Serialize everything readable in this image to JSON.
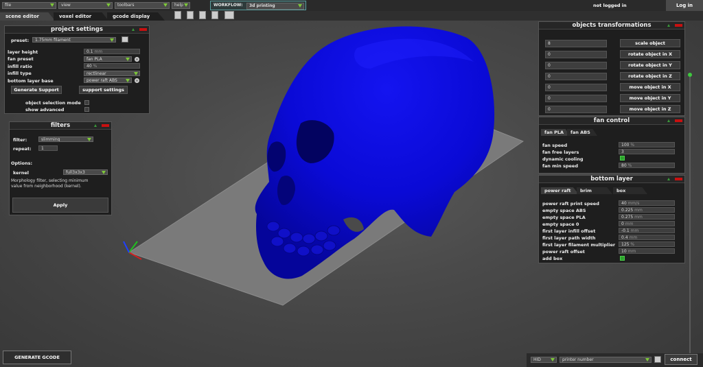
{
  "menus": [
    {
      "label": "file"
    },
    {
      "label": "view"
    },
    {
      "label": "toolbars"
    },
    {
      "label": "help"
    }
  ],
  "workflow": {
    "label": "WORKFLOW:",
    "value": "3d printing"
  },
  "auth": {
    "status": "not logged in",
    "login_label": "Log in"
  },
  "tabs": [
    {
      "label": "scene editor"
    },
    {
      "label": "voxel editor"
    },
    {
      "label": "gcode display"
    }
  ],
  "project_settings": {
    "title": "project settings",
    "preset_label": "preset:",
    "preset_value": "1.75mm filament",
    "rows": [
      {
        "label": "layer height",
        "value": "0.1",
        "unit": "mm",
        "kind": "field"
      },
      {
        "label": "fan preset",
        "value": "fan PLA",
        "kind": "select"
      },
      {
        "label": "infill ratio",
        "value": "40",
        "unit": "%",
        "kind": "field"
      },
      {
        "label": "infill type",
        "value": "rectlinear",
        "kind": "select"
      },
      {
        "label": "bottom layer base",
        "value": "power raft ABS",
        "kind": "select"
      }
    ],
    "generate_support": "Generate Support",
    "support_settings": "support settings",
    "object_selection_mode": "object selection mode",
    "show_advanced": "show advanced"
  },
  "filters": {
    "title": "filters",
    "filter_label": "filter:",
    "filter_value": "slimming",
    "repeat_label": "repeat:",
    "repeat_value": "1",
    "options_label": "Options:",
    "kernel_label": "kernel",
    "kernel_value": "full3x3x3",
    "description": "Morphology filter, selecting minimum value from neighborhood (kernel).",
    "apply": "Apply"
  },
  "objects_transformations": {
    "title": "objects transformations",
    "rows": [
      {
        "value": "8",
        "button": "scale object"
      },
      {
        "value": "0",
        "button": "rotate object in X"
      },
      {
        "value": "0",
        "button": "rotate object in Y"
      },
      {
        "value": "0",
        "button": "rotate object in Z"
      },
      {
        "value": "0",
        "button": "move object in X"
      },
      {
        "value": "0",
        "button": "move object in Y"
      },
      {
        "value": "0",
        "button": "move object in Z"
      }
    ]
  },
  "fan_control": {
    "title": "fan control",
    "tabs": [
      "fan PLA",
      "fan ABS"
    ],
    "fan_speed": {
      "label": "fan speed",
      "value": "100",
      "unit": "%"
    },
    "fan_free_layers": {
      "label": "fan free layers",
      "value": "3"
    },
    "dynamic_cooling": {
      "label": "dynamic cooling"
    },
    "fan_min_speed": {
      "label": "fan min speed",
      "value": "80",
      "unit": "%"
    }
  },
  "bottom_layer": {
    "title": "bottom layer",
    "tabs": [
      "power raft",
      "brim",
      "box"
    ],
    "rows": [
      {
        "label": "power raft print speed",
        "value": "40",
        "unit": "mm/s"
      },
      {
        "label": "empty space ABS",
        "value": "0.225",
        "unit": "mm"
      },
      {
        "label": "empty space PLA",
        "value": "0.275",
        "unit": "mm"
      },
      {
        "label": "empty space 0",
        "value": "0",
        "unit": "mm"
      },
      {
        "label": "first layer infill offset",
        "value": "-0.1",
        "unit": "mm"
      },
      {
        "label": "first layer path width",
        "value": "0.4",
        "unit": "mm"
      },
      {
        "label": "first layer filament multiplier",
        "value": "125",
        "unit": "%"
      },
      {
        "label": "power raft offset",
        "value": "10",
        "unit": "mm"
      }
    ],
    "add_box": "add box"
  },
  "bottom": {
    "generate_gcode": "GENERATE GCODE",
    "port_value": "HID",
    "printer_value": "printer number",
    "connect": "connect"
  },
  "colors": {
    "model": "#0a0ad8",
    "bed": "#7a7a7a",
    "accent_green": "#3ec83e",
    "close_red": "#c81010"
  }
}
